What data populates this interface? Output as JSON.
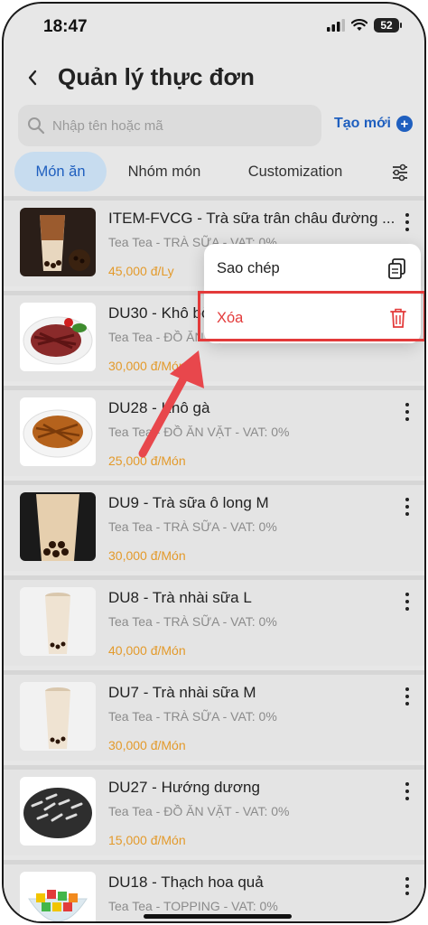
{
  "status_bar": {
    "time": "18:47",
    "battery": "52"
  },
  "header": {
    "title": "Quản lý thực đơn"
  },
  "search": {
    "placeholder": "Nhập tên hoặc mã"
  },
  "create_button": {
    "label": "Tạo mới"
  },
  "tabs": [
    {
      "label": "Món ăn",
      "active": true
    },
    {
      "label": "Nhóm món",
      "active": false
    },
    {
      "label": "Customization",
      "active": false
    }
  ],
  "items": [
    {
      "name": "ITEM-FVCG - Trà sữa trân châu đường ...",
      "sub": "Tea Tea - TRÀ SỮA - VAT: 0%",
      "price": "45,000 đ/Ly",
      "image": "milk-tea-brown-sugar"
    },
    {
      "name": "DU30 - Khô bò",
      "sub": "Tea Tea - ĐỒ ĂN VẶT - VAT: 0%",
      "price": "30,000 đ/Món",
      "image": "dried-beef"
    },
    {
      "name": "DU28 - Khô gà",
      "sub": "Tea Tea - ĐỒ ĂN VẶT - VAT: 0%",
      "price": "25,000 đ/Món",
      "image": "dried-chicken"
    },
    {
      "name": "DU9 - Trà sữa ô long M",
      "sub": "Tea Tea - TRÀ SỮA - VAT: 0%",
      "price": "30,000 đ/Món",
      "image": "oolong-milk-tea"
    },
    {
      "name": "DU8 - Trà nhài sữa L",
      "sub": "Tea Tea - TRÀ SỮA - VAT: 0%",
      "price": "40,000 đ/Món",
      "image": "jasmine-milk-tea"
    },
    {
      "name": "DU7 - Trà nhài sữa M",
      "sub": "Tea Tea - TRÀ SỮA - VAT: 0%",
      "price": "30,000 đ/Món",
      "image": "jasmine-milk-tea"
    },
    {
      "name": "DU27 - Hướng dương",
      "sub": "Tea Tea - ĐỒ ĂN VẶT - VAT: 0%",
      "price": "15,000 đ/Món",
      "image": "sunflower-seeds"
    },
    {
      "name": "DU18 - Thạch hoa quả",
      "sub": "Tea Tea - TOPPING - VAT: 0%",
      "price": "",
      "image": "fruit-jelly"
    }
  ],
  "context_menu": {
    "copy_label": "Sao chép",
    "delete_label": "Xóa"
  },
  "colors": {
    "accent": "#1f5fbf",
    "price": "#e39a2b",
    "delete": "#e33a3a",
    "annotation": "#e33a3a"
  }
}
